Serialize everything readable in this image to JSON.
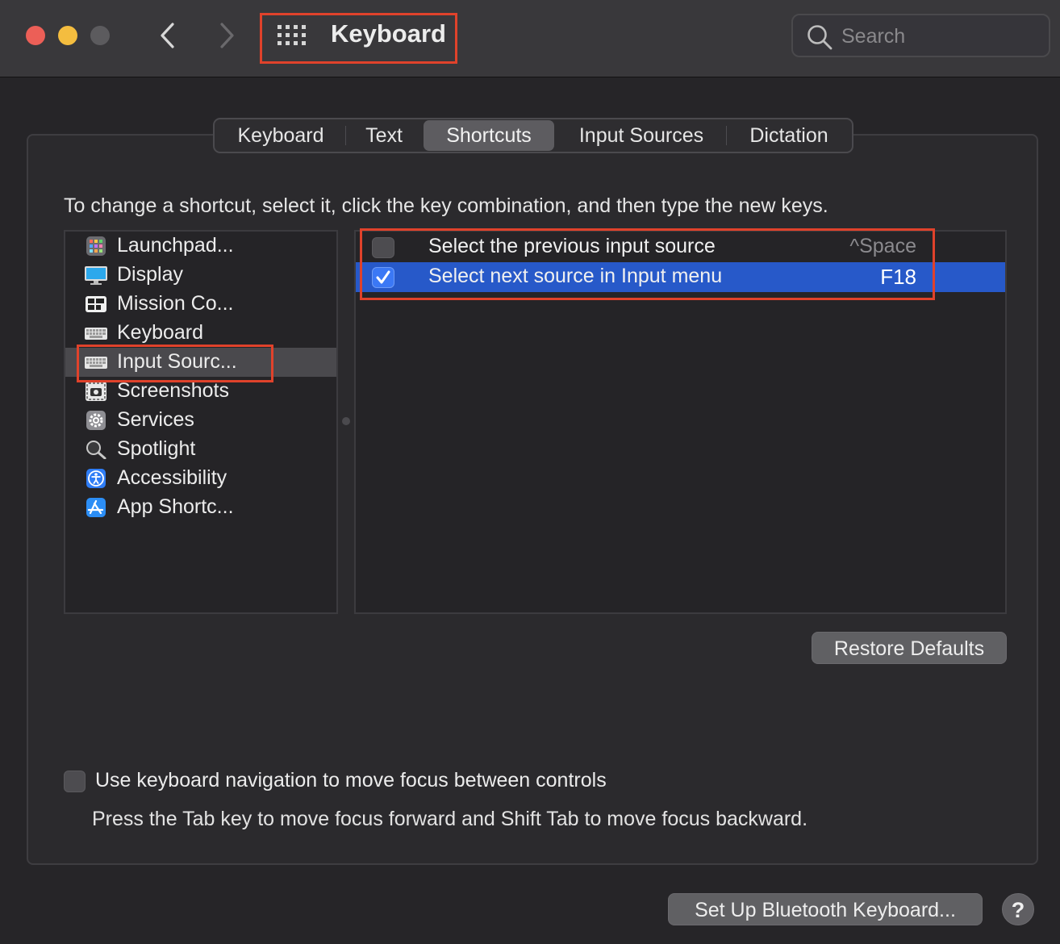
{
  "window": {
    "title": "Keyboard",
    "search_placeholder": "Search"
  },
  "tabs": [
    {
      "label": "Keyboard",
      "active": false
    },
    {
      "label": "Text",
      "active": false
    },
    {
      "label": "Shortcuts",
      "active": true
    },
    {
      "label": "Input Sources",
      "active": false
    },
    {
      "label": "Dictation",
      "active": false
    }
  ],
  "instruction": "To change a shortcut, select it, click the key combination, and then type the new keys.",
  "categories": [
    {
      "label": "Launchpad...",
      "icon": "launchpad-icon",
      "selected": false
    },
    {
      "label": "Display",
      "icon": "display-icon",
      "selected": false
    },
    {
      "label": "Mission Co...",
      "icon": "mission-control-icon",
      "selected": false
    },
    {
      "label": "Keyboard",
      "icon": "keyboard-icon",
      "selected": false
    },
    {
      "label": "Input Sourc...",
      "icon": "keyboard-icon",
      "selected": true
    },
    {
      "label": "Screenshots",
      "icon": "screenshot-icon",
      "selected": false
    },
    {
      "label": "Services",
      "icon": "gear-icon",
      "selected": false
    },
    {
      "label": "Spotlight",
      "icon": "magnifier-icon",
      "selected": false
    },
    {
      "label": "Accessibility",
      "icon": "accessibility-icon",
      "selected": false
    },
    {
      "label": "App Shortc...",
      "icon": "app-store-icon",
      "selected": false
    }
  ],
  "shortcuts": [
    {
      "name": "Select the previous input source",
      "key": "^Space",
      "checked": false,
      "selected": false
    },
    {
      "name": "Select next source in Input menu",
      "key": "F18",
      "checked": true,
      "selected": true
    }
  ],
  "buttons": {
    "restore_defaults": "Restore Defaults",
    "bluetooth": "Set Up Bluetooth Keyboard...",
    "help": "?"
  },
  "keyboard_navigation": {
    "label": "Use keyboard navigation to move focus between controls",
    "help": "Press the Tab key to move focus forward and Shift Tab to move focus backward.",
    "checked": false
  },
  "colors": {
    "selection_blue": "#2759c9",
    "highlight_red": "#e0422b"
  }
}
